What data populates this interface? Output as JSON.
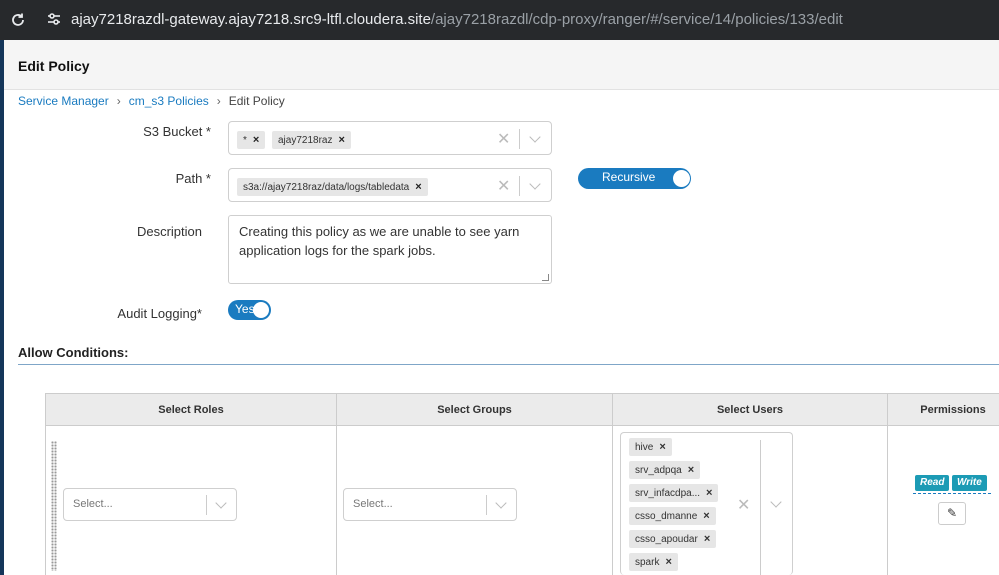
{
  "browser": {
    "url_host": "ajay7218razdl-gateway.ajay7218.src9-ltfl.cloudera.site",
    "url_path": "/ajay7218razdl/cdp-proxy/ranger/#/service/14/policies/133/edit"
  },
  "header": {
    "title": "Edit Policy"
  },
  "breadcrumb": {
    "item1": "Service Manager",
    "item2": "cm_s3 Policies",
    "item3": "Edit Policy",
    "separator": "›"
  },
  "form": {
    "s3_bucket_label": "S3 Bucket *",
    "s3_bucket_tags": [
      "*",
      "ajay7218raz"
    ],
    "path_label": "Path *",
    "path_tags": [
      "s3a://ajay7218raz/data/logs/tabledata"
    ],
    "recursive_label": "Recursive",
    "description_label": "Description",
    "description_value": "Creating this policy as we are unable to see yarn application logs for the spark jobs.",
    "audit_label": "Audit Logging*",
    "audit_value": "Yes"
  },
  "allow": {
    "title": "Allow Conditions:",
    "columns": [
      "Select Roles",
      "Select Groups",
      "Select Users",
      "Permissions"
    ],
    "roles_placeholder": "Select...",
    "groups_placeholder": "Select...",
    "users": [
      "hive",
      "srv_adpqa",
      "srv_infacdpa...",
      "csso_dmanne",
      "csso_apoudar",
      "spark"
    ],
    "permissions": [
      "Read",
      "Write"
    ]
  },
  "icons": {
    "remove": "×",
    "clear": "✕",
    "edit": "✎"
  },
  "colors": {
    "accent": "#1a7bc0",
    "permission": "#1c9bb5"
  }
}
